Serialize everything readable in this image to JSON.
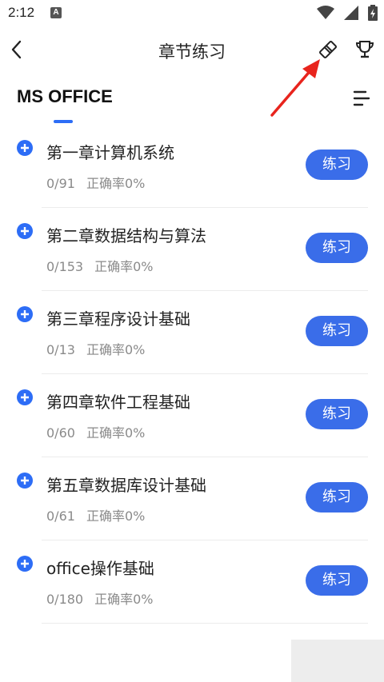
{
  "status_bar": {
    "time": "2:12",
    "notice_letter": "A"
  },
  "header": {
    "title": "章节练习"
  },
  "section": {
    "title": "MS OFFICE"
  },
  "chapters": [
    {
      "name": "第一章计算机系统",
      "progress": "0/91",
      "accuracy": "正确率0%",
      "button": "练习"
    },
    {
      "name": "第二章数据结构与算法",
      "progress": "0/153",
      "accuracy": "正确率0%",
      "button": "练习"
    },
    {
      "name": "第三章程序设计基础",
      "progress": "0/13",
      "accuracy": "正确率0%",
      "button": "练习"
    },
    {
      "name": "第四章软件工程基础",
      "progress": "0/60",
      "accuracy": "正确率0%",
      "button": "练习"
    },
    {
      "name": "第五章数据库设计基础",
      "progress": "0/61",
      "accuracy": "正确率0%",
      "button": "练习"
    },
    {
      "name": "office操作基础",
      "progress": "0/180",
      "accuracy": "正确率0%",
      "button": "练习"
    }
  ],
  "colors": {
    "accent": "#2d6df6",
    "button": "#3a6de9",
    "arrow": "#e8241d"
  },
  "icons": [
    "back-arrow-icon",
    "eraser-icon",
    "trophy-icon",
    "menu-icon",
    "plus-circle-icon",
    "wifi-icon",
    "signal-icon",
    "battery-icon"
  ]
}
